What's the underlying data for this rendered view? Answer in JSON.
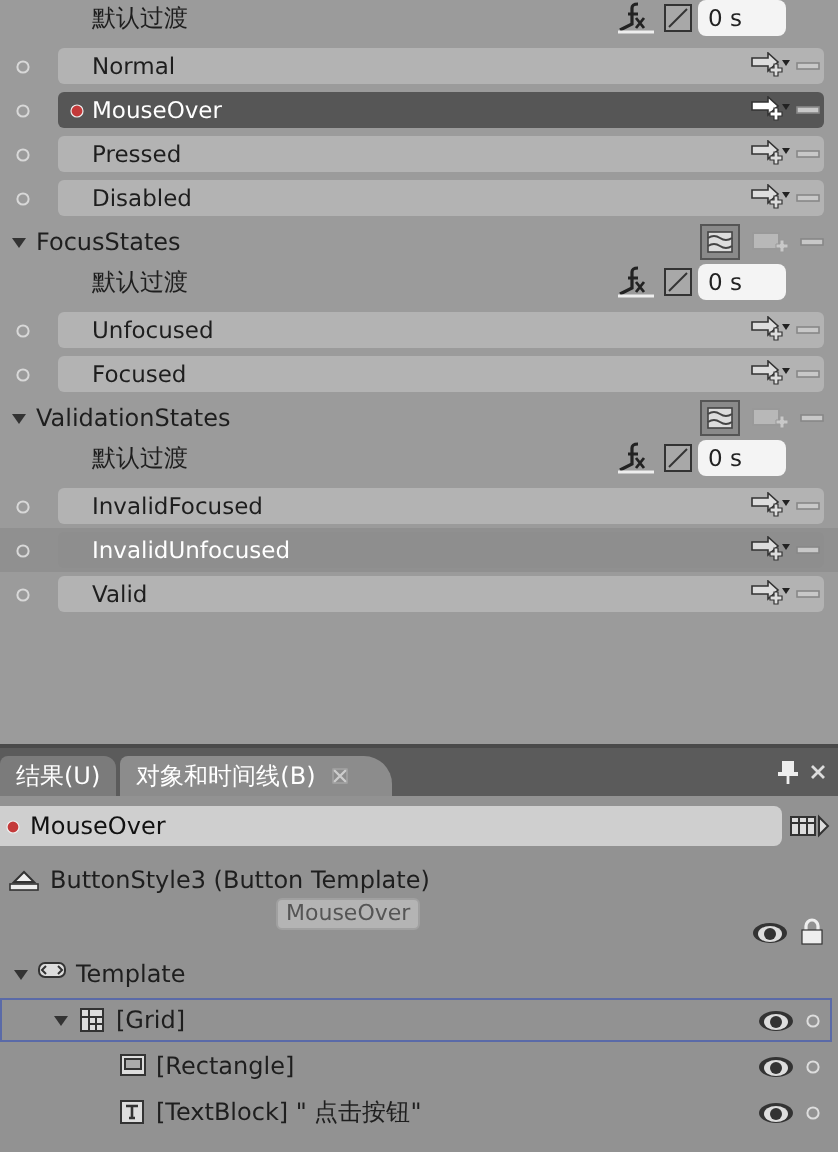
{
  "state_groups": [
    {
      "transition": {
        "label": "默认过渡",
        "duration": "0 s"
      },
      "states": [
        {
          "name": "Normal",
          "selected": false,
          "hovered": false
        },
        {
          "name": "MouseOver",
          "selected": true,
          "hovered": false
        },
        {
          "name": "Pressed",
          "selected": false,
          "hovered": false
        },
        {
          "name": "Disabled",
          "selected": false,
          "hovered": false
        }
      ]
    },
    {
      "name": "FocusStates",
      "expanded": true,
      "transition": {
        "label": "默认过渡",
        "duration": "0 s"
      },
      "states": [
        {
          "name": "Unfocused",
          "selected": false,
          "hovered": false
        },
        {
          "name": "Focused",
          "selected": false,
          "hovered": false
        }
      ]
    },
    {
      "name": "ValidationStates",
      "expanded": true,
      "transition": {
        "label": "默认过渡",
        "duration": "0 s"
      },
      "states": [
        {
          "name": "InvalidFocused",
          "selected": false,
          "hovered": false
        },
        {
          "name": "InvalidUnfocused",
          "selected": false,
          "hovered": true
        },
        {
          "name": "Valid",
          "selected": false,
          "hovered": false
        }
      ]
    }
  ],
  "bottom_panel": {
    "tabs": [
      {
        "label": "结果(U)",
        "selected": false,
        "closable": false
      },
      {
        "label": "对象和时间线(B)",
        "selected": true,
        "closable": true
      }
    ],
    "current_state": {
      "name": "MouseOver",
      "recording": true
    },
    "scope": {
      "label": "ButtonStyle3 (Button Template)",
      "tooltip": "MouseOver"
    },
    "tree": [
      {
        "label": "Template",
        "kind": "template",
        "expanded": true,
        "selected": false,
        "eye": false,
        "children": [
          {
            "label": "[Grid]",
            "kind": "grid",
            "expanded": true,
            "selected": true,
            "eye": true,
            "children": [
              {
                "label": "[Rectangle]",
                "kind": "rectangle",
                "selected": false,
                "eye": true
              },
              {
                "label": "[TextBlock] \" 点击按钮\"",
                "kind": "textblock",
                "selected": false,
                "eye": true
              }
            ]
          }
        ]
      }
    ]
  }
}
